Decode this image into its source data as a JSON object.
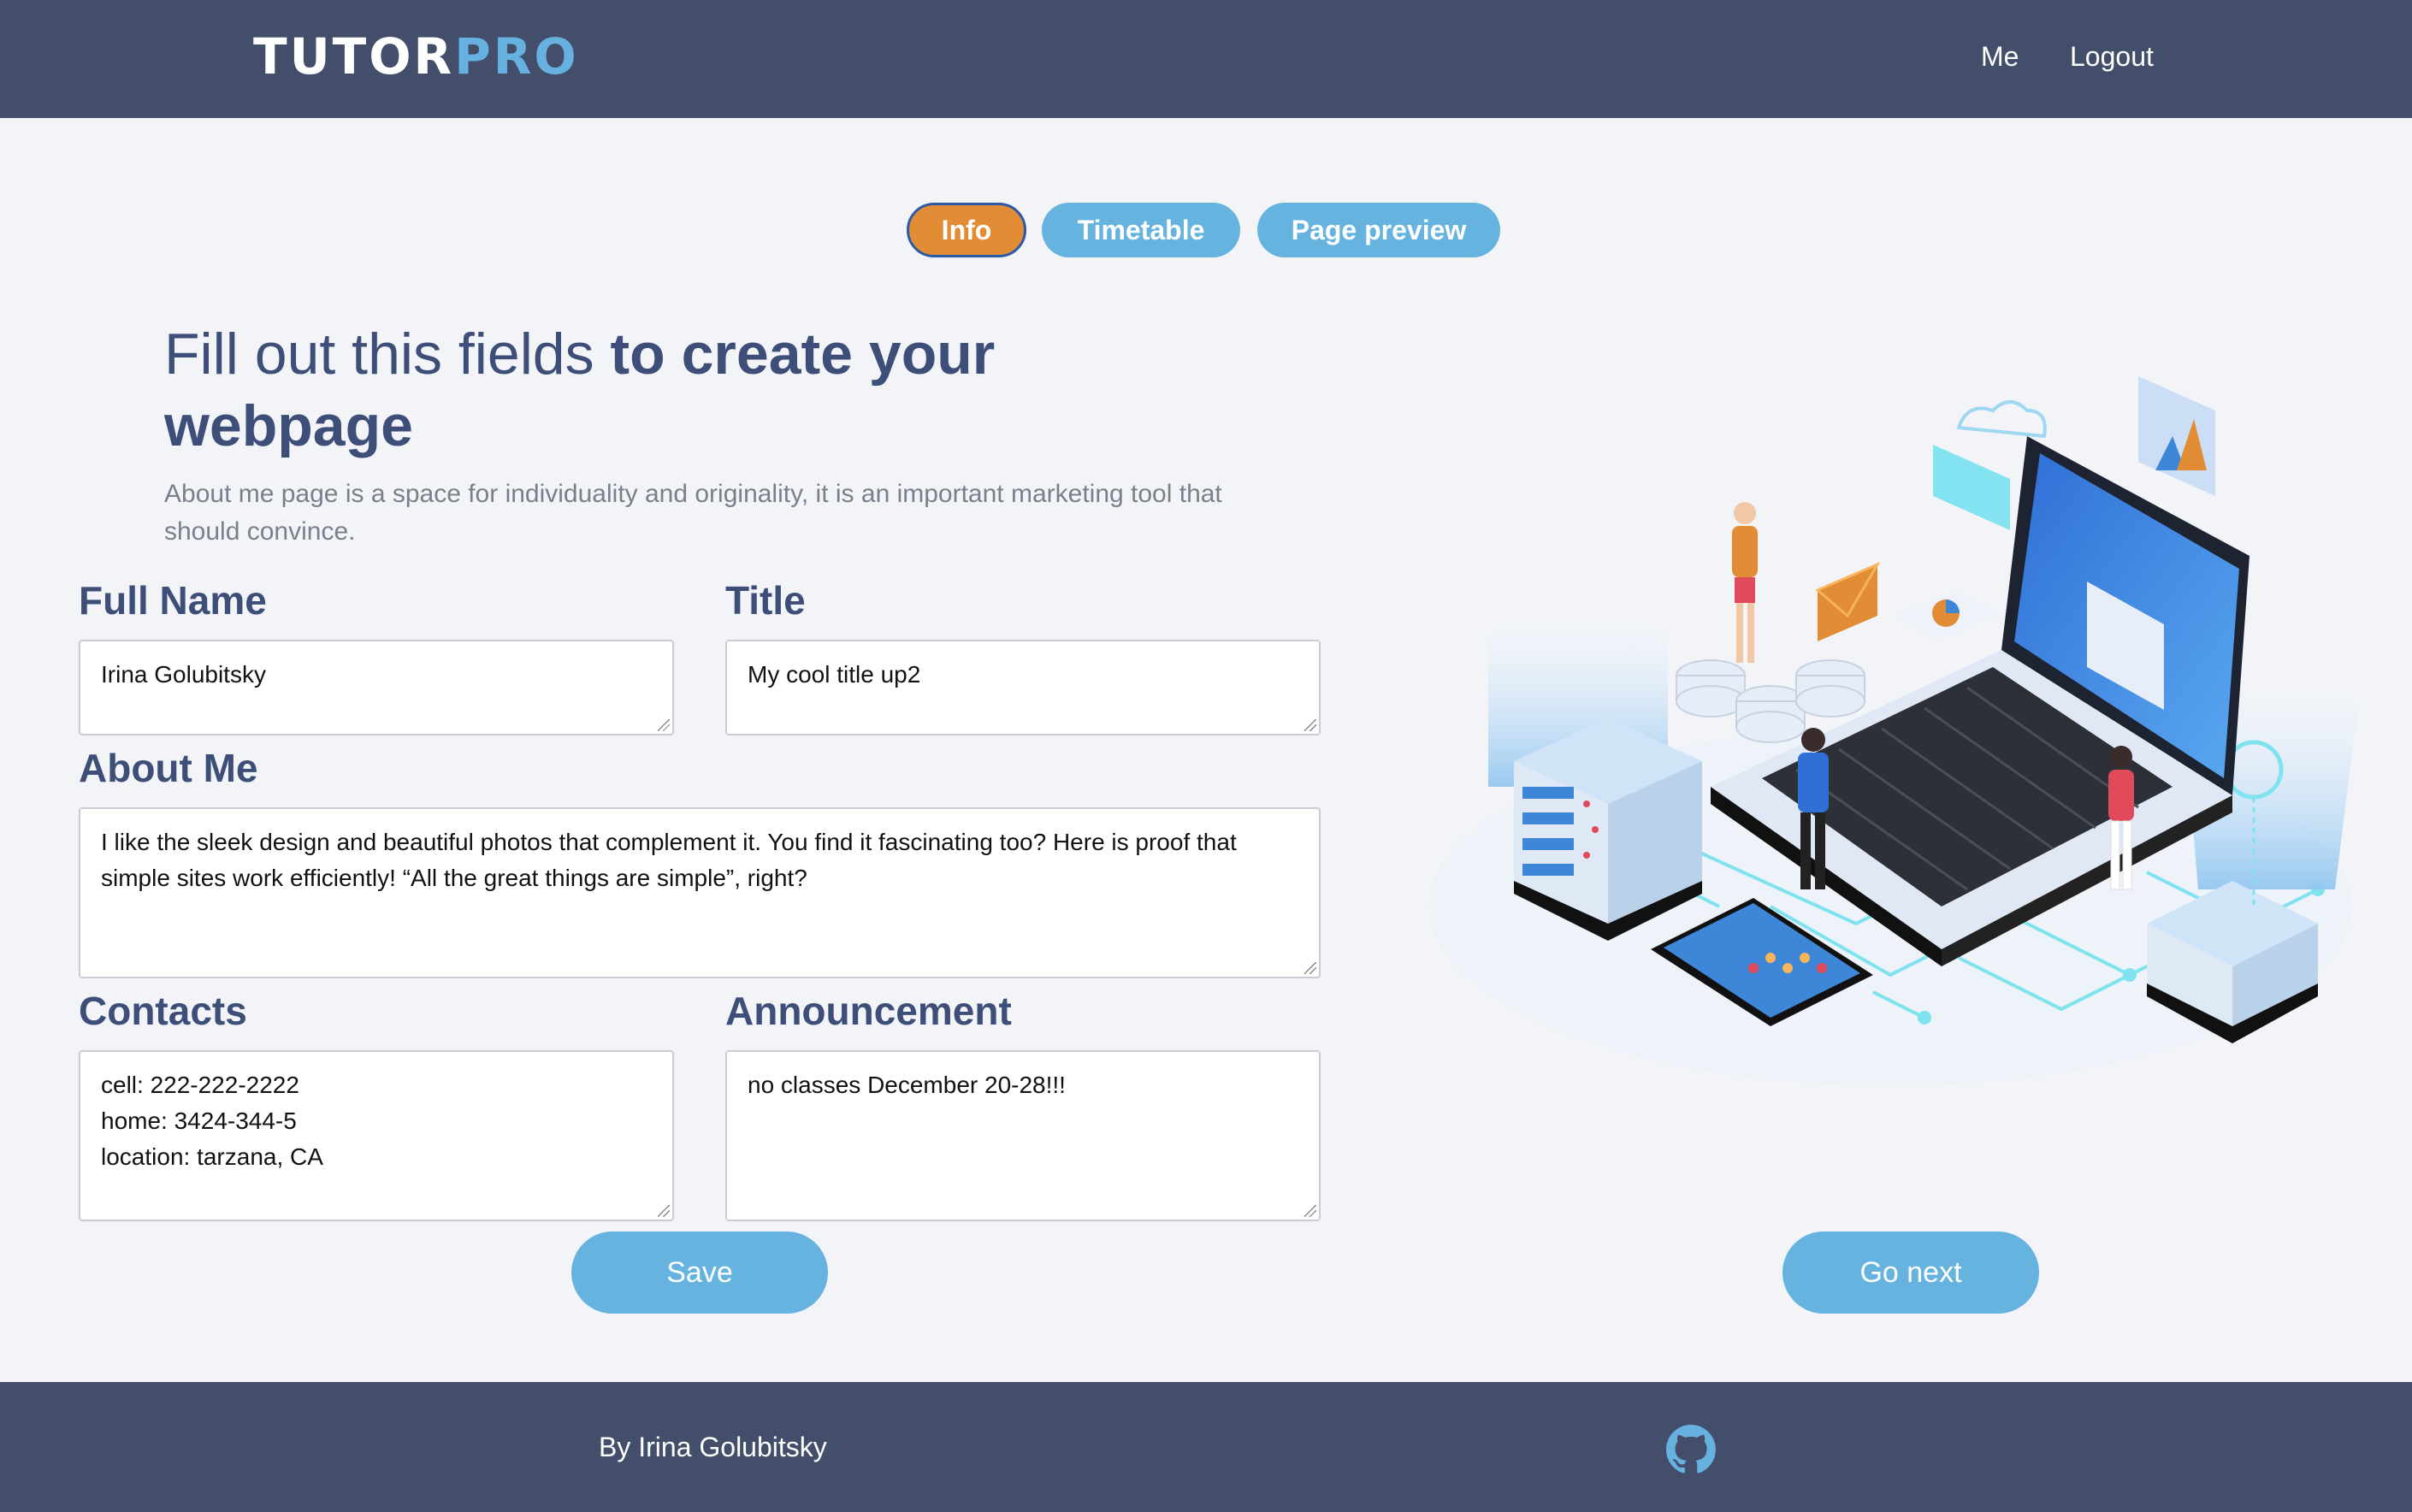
{
  "header": {
    "logo_part1": "TUTOR",
    "logo_part2": "PRO",
    "nav": {
      "me": "Me",
      "logout": "Logout"
    }
  },
  "tabs": [
    {
      "label": "Info",
      "active": true
    },
    {
      "label": "Timetable",
      "active": false
    },
    {
      "label": "Page preview",
      "active": false
    }
  ],
  "intro": {
    "headline_regular": "Fill out this fields ",
    "headline_bold": "to create your webpage",
    "subtext": "About me page is a space for individuality and originality, it is an important marketing tool that should convince."
  },
  "form": {
    "full_name": {
      "label": "Full Name",
      "value": "Irina Golubitsky"
    },
    "title": {
      "label": "Title",
      "value": "My cool title up2"
    },
    "about_me": {
      "label": "About Me",
      "value": "I like the sleek design and beautiful photos that complement it. You find it fascinating too? Here is proof that simple sites work efficiently! “All the great things are simple”, right?"
    },
    "contacts": {
      "label": "Contacts",
      "value": "cell: 222-222-2222\nhome: 3424-344-5\nlocation: tarzana, CA"
    },
    "announcement": {
      "label": "Announcement",
      "value": "no classes December 20-28!!!"
    }
  },
  "buttons": {
    "save": "Save",
    "go_next": "Go next"
  },
  "footer": {
    "credit": "By Irina Golubitsky",
    "icon": "github-icon"
  },
  "colors": {
    "header_bg": "#434e6b",
    "accent_blue": "#66b3e0",
    "active_tab": "#e28d36",
    "heading_text": "#3d4f78"
  }
}
